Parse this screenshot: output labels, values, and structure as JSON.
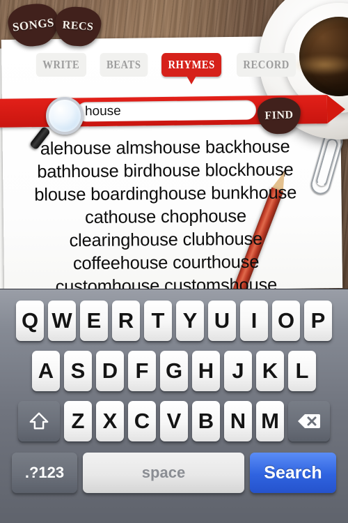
{
  "app": {
    "background": "wood-desk",
    "accent_red": "#d6211a",
    "pick_brown": "#41211c"
  },
  "corner_tabs": [
    {
      "label": "SONGS",
      "name": "pick-tab-songs"
    },
    {
      "label": "RECS",
      "name": "pick-tab-recs"
    }
  ],
  "tabs": [
    {
      "label": "WRITE",
      "active": false
    },
    {
      "label": "BEATS",
      "active": false
    },
    {
      "label": "RHYMES",
      "active": true
    },
    {
      "label": "RECORD",
      "active": false
    }
  ],
  "search": {
    "value": "house",
    "placeholder": "house",
    "button_label": "FIND",
    "icon": "magnifier-icon"
  },
  "results": {
    "lines": [
      "alehouse almshouse backhouse",
      "bathhouse birdhouse blockhouse",
      "blouse boardinghouse bunkhouse",
      "cathouse chophouse",
      "clearinghouse clubhouse",
      "coffeehouse courthouse",
      "customhouse customshouse"
    ]
  },
  "keyboard": {
    "row1": [
      "Q",
      "W",
      "E",
      "R",
      "T",
      "Y",
      "U",
      "I",
      "O",
      "P"
    ],
    "row2": [
      "A",
      "S",
      "D",
      "F",
      "G",
      "H",
      "J",
      "K",
      "L"
    ],
    "row3": [
      "Z",
      "X",
      "C",
      "V",
      "B",
      "N",
      "M"
    ],
    "shift_label": "",
    "delete_label": "",
    "numeric_label": ".?123",
    "space_label": "space",
    "search_label": "Search",
    "search_key_color": "#2f63e0"
  },
  "decorations": {
    "coffee_cup": "coffee-cup",
    "pencil": "red-pencil",
    "paperclip": "paperclip"
  }
}
